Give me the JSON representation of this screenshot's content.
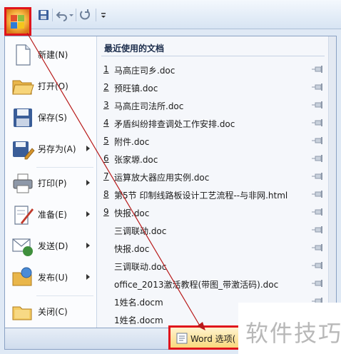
{
  "colors": {
    "highlight": "#e0141b",
    "menu_border": "#8aa1c3",
    "arrow": "#b81a1a"
  },
  "quick_access": {
    "office_button_icon": "office-logo-icon",
    "icons": [
      "save-icon",
      "undo-icon",
      "redo-icon",
      "customize-dropdown-icon"
    ]
  },
  "menu": {
    "commands": [
      {
        "label": "新建(N)",
        "icon": "new-document-icon",
        "has_submenu": false
      },
      {
        "label": "打开(O)",
        "icon": "open-folder-icon",
        "has_submenu": false
      },
      {
        "label": "保存(S)",
        "icon": "save-disk-icon",
        "has_submenu": false
      },
      {
        "label": "另存为(A)",
        "icon": "save-as-icon",
        "has_submenu": true
      },
      {
        "label": "打印(P)",
        "icon": "printer-icon",
        "has_submenu": true
      },
      {
        "label": "准备(E)",
        "icon": "prepare-icon",
        "has_submenu": true
      },
      {
        "label": "发送(D)",
        "icon": "send-icon",
        "has_submenu": true
      },
      {
        "label": "发布(U)",
        "icon": "publish-icon",
        "has_submenu": true
      },
      {
        "label": "关闭(C)",
        "icon": "close-folder-icon",
        "has_submenu": false
      }
    ],
    "recent": {
      "title": "最近使用的文档",
      "documents": [
        {
          "num": "1",
          "name": "马高庄司乡.doc"
        },
        {
          "num": "2",
          "name": "预旺镇.doc"
        },
        {
          "num": "3",
          "name": "马高庄司法所.doc"
        },
        {
          "num": "4",
          "name": "矛盾纠纷排查调处工作安排.doc"
        },
        {
          "num": "5",
          "name": "附件.doc"
        },
        {
          "num": "6",
          "name": "张家塬.doc"
        },
        {
          "num": "7",
          "name": "运算放大器应用实例.doc"
        },
        {
          "num": "8",
          "name": "第5节 印制线路板设计工艺流程--与非网.html"
        },
        {
          "num": "9",
          "name": "快报.doc"
        },
        {
          "num": "",
          "name": "三调联动.doc"
        },
        {
          "num": "",
          "name": "快报.doc"
        },
        {
          "num": "",
          "name": "三调联动.doc"
        },
        {
          "num": "",
          "name": "office_2013激活教程(带图_带激活码).doc"
        },
        {
          "num": "",
          "name": "1姓名.docm"
        },
        {
          "num": "",
          "name": "1姓名.docm"
        }
      ]
    }
  },
  "footer": {
    "word_options_label": "Word 选项(",
    "watermark": "软件技巧"
  }
}
